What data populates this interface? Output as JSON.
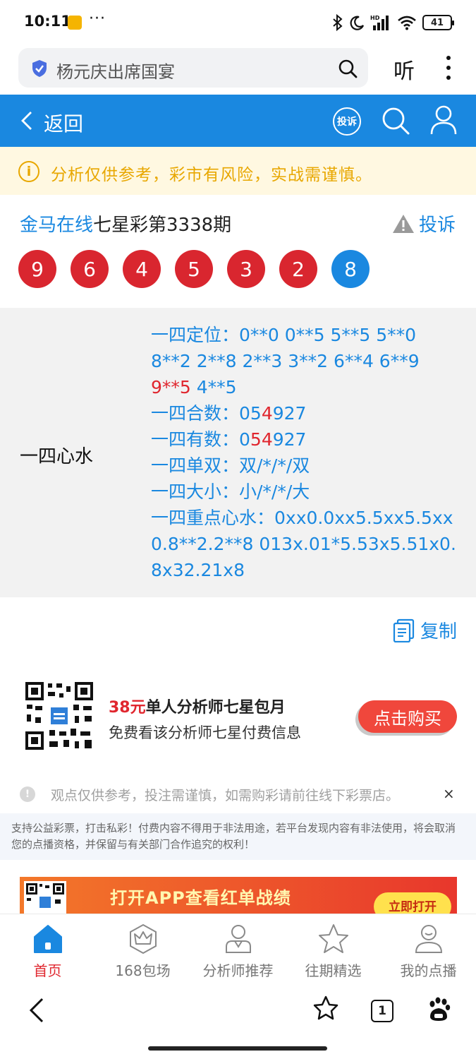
{
  "status_bar": {
    "time": "10:11",
    "dots": "···",
    "signal_label": "HD",
    "battery": "41"
  },
  "browser": {
    "search_text": "杨元庆出席国宴",
    "listen_label": "听"
  },
  "header": {
    "back_label": "返回",
    "complain_icon_label": "投诉"
  },
  "notice": {
    "icon": "i",
    "text": "分析仅供参考，彩市有风险，实战需谨慎。"
  },
  "issue": {
    "site": "金马在线",
    "title": "七星彩第3338期",
    "complain_label": "投诉"
  },
  "balls": [
    {
      "value": "9",
      "color": "red"
    },
    {
      "value": "6",
      "color": "red"
    },
    {
      "value": "4",
      "color": "red"
    },
    {
      "value": "5",
      "color": "red"
    },
    {
      "value": "3",
      "color": "red"
    },
    {
      "value": "2",
      "color": "red"
    },
    {
      "value": "8",
      "color": "blue"
    }
  ],
  "analysis": {
    "label": "一四心水",
    "ding_a": "一四定位：0**0 0**5 5**5 5**0 8**2 2**8 2**3 3**2 6**4 6**9 ",
    "ding_red": "9**5",
    "ding_b": " 4**5",
    "he_a": "一四合数：05",
    "he_red": "4",
    "he_b": "927",
    "you_a": "一四有数：0",
    "you_red1": "5",
    "you_red2": "4",
    "you_b": "927",
    "danshuang": "一四单双：双/*/*/双",
    "daxiao": "一四大小：小/*/*/大",
    "zhongdian": "一四重点心水：0xx0.0xx5.5xx5.5xx0.8**2.2**8 013x.01*5.53x5.51x0.8x32.21x8"
  },
  "copy_label": "复制",
  "promo": {
    "price": "38元",
    "title": "单人分析师七星包月",
    "subtitle": "免费看该分析师七星付费信息",
    "buy_label": "点击购买"
  },
  "tip": {
    "icon": "!",
    "text": "观点仅供参考，投注需谨慎，如需购彩请前往线下彩票店。",
    "close": "×"
  },
  "disclaimer": "支持公益彩票，打击私彩！付费内容不得用于非法用途，若平台发现内容有非法使用，将会取消您的点播资格，并保留与有关部门合作追究的权利！",
  "banner": {
    "text": "打开APP查看红单战绩",
    "button": "立即打开"
  },
  "tabs": [
    {
      "label": "首页",
      "icon": "home-icon",
      "active": true
    },
    {
      "label": "168包场",
      "icon": "crown-icon",
      "active": false
    },
    {
      "label": "分析师推荐",
      "icon": "analyst-icon",
      "active": false
    },
    {
      "label": "往期精选",
      "icon": "star-icon",
      "active": false
    },
    {
      "label": "我的点播",
      "icon": "profile-icon",
      "active": false
    }
  ],
  "bottom_nav": {
    "tab_count": "1"
  },
  "colors": {
    "brand_blue": "#1a88e0",
    "red": "#d9262f",
    "notice_yellow": "#e8a700"
  }
}
